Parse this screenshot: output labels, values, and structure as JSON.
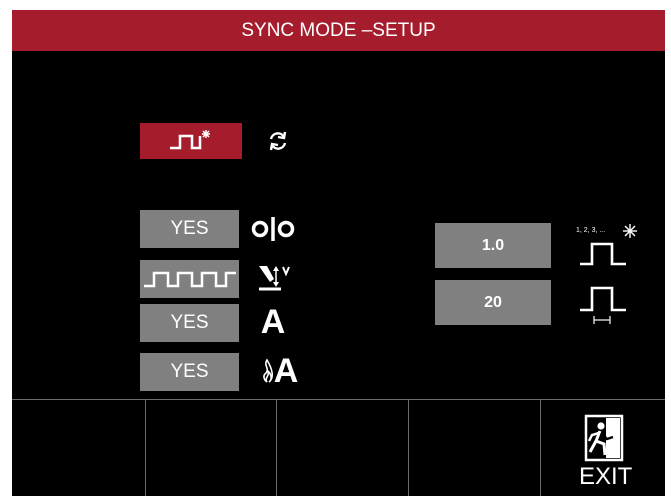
{
  "header": {
    "title": "SYNC MODE –SETUP"
  },
  "mode": {
    "active_icon": "pulse-spark-icon",
    "sync_icon": "refresh-icon"
  },
  "left_rows": [
    {
      "value": "YES",
      "icon": "gap-icon"
    },
    {
      "value": "",
      "icon": "torch-height-icon",
      "button_icon": "multi-pulse-icon"
    },
    {
      "value": "YES",
      "icon": "current-a-icon"
    },
    {
      "value": "YES",
      "icon": "flame-current-icon"
    }
  ],
  "right_rows": [
    {
      "value": "1.0",
      "icon": "pulse-count-spark-icon",
      "icon_label": "1, 2, 3, ..."
    },
    {
      "value": "20",
      "icon": "pulse-width-icon"
    }
  ],
  "icon_letters": {
    "a": "A"
  },
  "footer": {
    "exit_label": "EXIT"
  },
  "colors": {
    "accent": "#a51d2d",
    "button": "#808080",
    "background": "#000000"
  }
}
